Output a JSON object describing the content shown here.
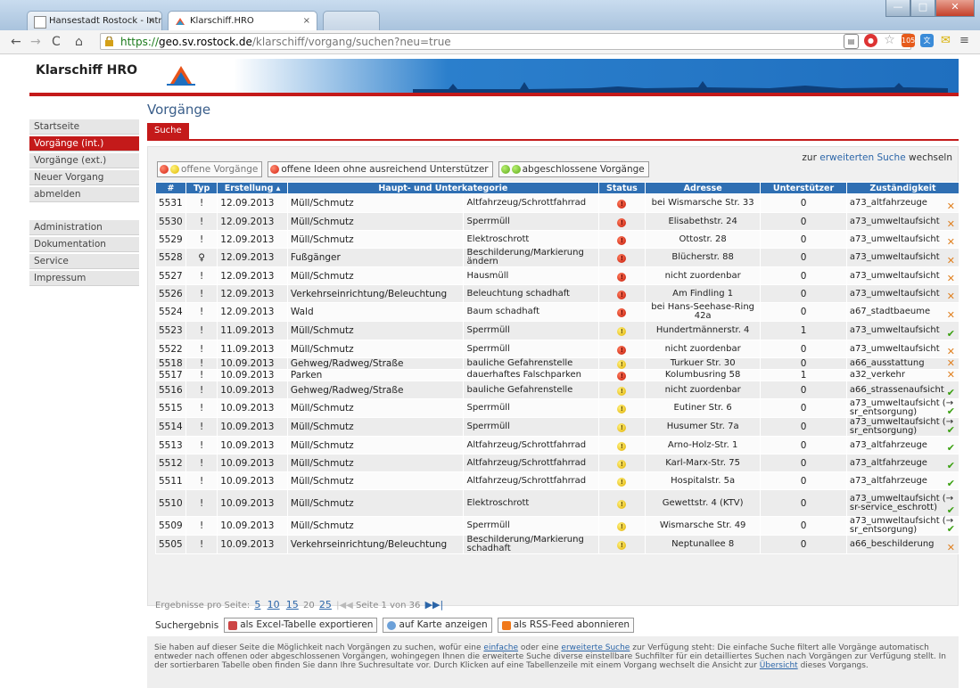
{
  "browser": {
    "tabs": [
      {
        "label": "Hansestadt Rostock - Intr",
        "close": "×"
      },
      {
        "label": "Klarschiff.HRO",
        "close": "×"
      }
    ],
    "url_scheme": "https://",
    "url_host": "geo.sv.rostock.de",
    "url_path": "/klarschiff/vorgang/suchen?neu=true",
    "window_buttons": {
      "minimize": "—",
      "maximize": "□",
      "close": "✕"
    },
    "ext_badge": "105"
  },
  "site": {
    "logo_text": "Klarschiff HRO"
  },
  "sidebar": {
    "group1": [
      "Startseite",
      "Vorgänge (int.)",
      "Vorgänge (ext.)",
      "Neuer Vorgang",
      "abmelden"
    ],
    "group2": [
      "Administration",
      "Dokumentation",
      "Service",
      "Impressum"
    ],
    "active_index": 1
  },
  "main": {
    "title": "Vorgänge",
    "tab": "Suche",
    "ext_search": {
      "prefix": "zur",
      "link": "erweiterten Suche",
      "suffix": "wechseln"
    },
    "filters": [
      "offene Vorgänge",
      "offene Ideen ohne ausreichend Unterstützer",
      "abgeschlossene Vorgänge"
    ],
    "columns": [
      "#",
      "Typ",
      "Erstellung ▴",
      "Haupt- und Unterkategorie",
      "Status",
      "Adresse",
      "Unterstützer",
      "Zuständigkeit"
    ],
    "rows": [
      {
        "id": "5531",
        "typ": "!",
        "date": "12.09.2013",
        "kat1": "Müll/Schmutz",
        "kat2": "Altfahrzeug/Schrottfahrrad",
        "status": "red",
        "addr": "bei Wismarsche Str. 33",
        "sup": "0",
        "zust": "a73_altfahrzeuge",
        "mark": "x"
      },
      {
        "id": "5530",
        "typ": "!",
        "date": "12.09.2013",
        "kat1": "Müll/Schmutz",
        "kat2": "Sperrmüll",
        "status": "red",
        "addr": "Elisabethstr. 24",
        "sup": "0",
        "zust": "a73_umweltaufsicht",
        "mark": "x"
      },
      {
        "id": "5529",
        "typ": "!",
        "date": "12.09.2013",
        "kat1": "Müll/Schmutz",
        "kat2": "Elektroschrott",
        "status": "red",
        "addr": "Ottostr. 28",
        "sup": "0",
        "zust": "a73_umweltaufsicht",
        "mark": "x"
      },
      {
        "id": "5528",
        "typ": "♀",
        "date": "12.09.2013",
        "kat1": "Fußgänger",
        "kat2": "Beschilderung/Markierung ändern",
        "status": "red",
        "addr": "Blücherstr. 88",
        "sup": "0",
        "zust": "a73_umweltaufsicht",
        "mark": "x"
      },
      {
        "id": "5527",
        "typ": "!",
        "date": "12.09.2013",
        "kat1": "Müll/Schmutz",
        "kat2": "Hausmüll",
        "status": "red",
        "addr": "nicht zuordenbar",
        "sup": "0",
        "zust": "a73_umweltaufsicht",
        "mark": "x"
      },
      {
        "id": "5526",
        "typ": "!",
        "date": "12.09.2013",
        "kat1": "Verkehrseinrichtung/Beleuchtung",
        "kat2": "Beleuchtung schadhaft",
        "status": "red",
        "addr": "Am Findling 1",
        "sup": "0",
        "zust": "a73_umweltaufsicht",
        "mark": "x"
      },
      {
        "id": "5524",
        "typ": "!",
        "date": "12.09.2013",
        "kat1": "Wald",
        "kat2": "Baum schadhaft",
        "status": "red",
        "addr": "bei Hans-Seehase-Ring 42a",
        "sup": "0",
        "zust": "a67_stadtbaeume",
        "mark": "x"
      },
      {
        "id": "5523",
        "typ": "!",
        "date": "11.09.2013",
        "kat1": "Müll/Schmutz",
        "kat2": "Sperrmüll",
        "status": "yel",
        "addr": "Hundertmännerstr. 4",
        "sup": "1",
        "zust": "a73_umweltaufsicht",
        "mark": "ok"
      },
      {
        "id": "5522",
        "typ": "!",
        "date": "11.09.2013",
        "kat1": "Müll/Schmutz",
        "kat2": "Sperrmüll",
        "status": "red",
        "addr": "nicht zuordenbar",
        "sup": "0",
        "zust": "a73_umweltaufsicht",
        "mark": "x"
      },
      {
        "id": "5518",
        "typ": "!",
        "date": "10.09.2013",
        "kat1": "Gehweg/Radweg/Straße",
        "kat2": "bauliche Gefahrenstelle",
        "status": "yel",
        "addr": "Turkuer Str. 30",
        "sup": "0",
        "zust": "a66_ausstattung",
        "mark": "x"
      },
      {
        "id": "5517",
        "typ": "!",
        "date": "10.09.2013",
        "kat1": "Parken",
        "kat2": "dauerhaftes Falschparken",
        "status": "red",
        "addr": "Kolumbusring 58",
        "sup": "1",
        "zust": "a32_verkehr",
        "mark": "x"
      },
      {
        "id": "5516",
        "typ": "!",
        "date": "10.09.2013",
        "kat1": "Gehweg/Radweg/Straße",
        "kat2": "bauliche Gefahrenstelle",
        "status": "yel",
        "addr": "nicht zuordenbar",
        "sup": "0",
        "zust": "a66_strassenaufsicht",
        "mark": "ok"
      },
      {
        "id": "5515",
        "typ": "!",
        "date": "10.09.2013",
        "kat1": "Müll/Schmutz",
        "kat2": "Sperrmüll",
        "status": "yel",
        "addr": "Eutiner Str. 6",
        "sup": "0",
        "zust": "a73_umweltaufsicht (→ sr_entsorgung)",
        "mark": "ok"
      },
      {
        "id": "5514",
        "typ": "!",
        "date": "10.09.2013",
        "kat1": "Müll/Schmutz",
        "kat2": "Sperrmüll",
        "status": "yel",
        "addr": "Husumer Str. 7a",
        "sup": "0",
        "zust": "a73_umweltaufsicht (→ sr_entsorgung)",
        "mark": "ok"
      },
      {
        "id": "5513",
        "typ": "!",
        "date": "10.09.2013",
        "kat1": "Müll/Schmutz",
        "kat2": "Altfahrzeug/Schrottfahrrad",
        "status": "yel",
        "addr": "Arno-Holz-Str. 1",
        "sup": "0",
        "zust": "a73_altfahrzeuge",
        "mark": "ok"
      },
      {
        "id": "5512",
        "typ": "!",
        "date": "10.09.2013",
        "kat1": "Müll/Schmutz",
        "kat2": "Altfahrzeug/Schrottfahrrad",
        "status": "yel",
        "addr": "Karl-Marx-Str. 75",
        "sup": "0",
        "zust": "a73_altfahrzeuge",
        "mark": "ok"
      },
      {
        "id": "5511",
        "typ": "!",
        "date": "10.09.2013",
        "kat1": "Müll/Schmutz",
        "kat2": "Altfahrzeug/Schrottfahrrad",
        "status": "yel",
        "addr": "Hospitalstr. 5a",
        "sup": "0",
        "zust": "a73_altfahrzeuge",
        "mark": "ok"
      },
      {
        "id": "5510",
        "typ": "!",
        "date": "10.09.2013",
        "kat1": "Müll/Schmutz",
        "kat2": "Elektroschrott",
        "status": "yel",
        "addr": "Gewettstr. 4 (KTV)",
        "sup": "0",
        "zust": "a73_umweltaufsicht (→ sr-service_eschrott)",
        "mark": "ok"
      },
      {
        "id": "5509",
        "typ": "!",
        "date": "10.09.2013",
        "kat1": "Müll/Schmutz",
        "kat2": "Sperrmüll",
        "status": "yel",
        "addr": "Wismarsche Str. 49",
        "sup": "0",
        "zust": "a73_umweltaufsicht (→ sr_entsorgung)",
        "mark": "ok"
      },
      {
        "id": "5505",
        "typ": "!",
        "date": "10.09.2013",
        "kat1": "Verkehrseinrichtung/Beleuchtung",
        "kat2": "Beschilderung/Markierung schadhaft",
        "status": "yel",
        "addr": "Neptunallee 8",
        "sup": "0",
        "zust": "a66_beschilderung",
        "mark": "x"
      }
    ],
    "pager": {
      "label": "Ergebnisse pro Seite:",
      "sizes": [
        "5",
        "10",
        "15",
        "20",
        "25"
      ],
      "page_text": "Seite 1 von 36"
    },
    "export": {
      "label": "Suchergebnis",
      "excel": "als Excel-Tabelle exportieren",
      "map": "auf Karte anzeigen",
      "rss": "als RSS-Feed abonnieren"
    }
  },
  "help": {
    "t1": "Sie haben auf dieser Seite die Möglichkeit nach Vorgängen zu suchen, wofür eine",
    "l1": "einfache",
    "t2": "oder eine",
    "l2": "erweiterte Suche",
    "t3": "zur Verfügung steht: Die einfache Suche filtert alle Vorgänge automatisch entweder nach offenen oder abgeschlossenen Vorgängen, wohingegen Ihnen die erweiterte Suche diverse einstellbare Suchfilter für ein detailliertes Suchen nach Vorgängen zur Verfügung stellt. In der sortierbaren Tabelle oben finden Sie dann Ihre Suchresultate vor. Durch Klicken auf eine Tabellenzeile mit einem Vorgang wechselt die Ansicht zur",
    "l3": "Übersicht",
    "t4": "dieses Vorgangs."
  },
  "colors": {
    "brand_red": "#c41a1a",
    "header_blue": "#2f6fb3",
    "link": "#2b65a8"
  }
}
